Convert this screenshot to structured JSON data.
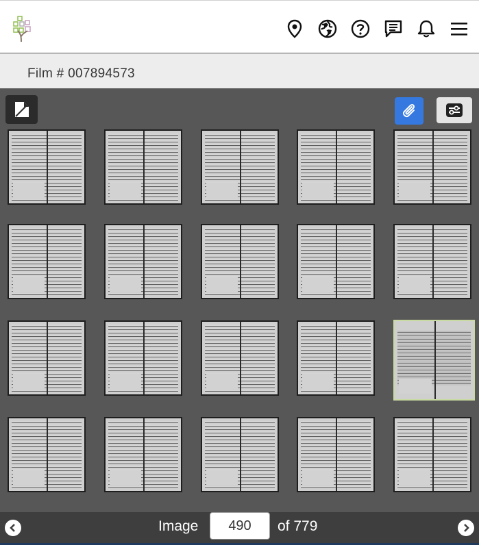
{
  "header": {
    "logo_icon": "familysearch-tree-logo",
    "nav_icons": [
      "map-pin-icon",
      "globe-icon",
      "help-icon",
      "chat-icon",
      "bell-icon",
      "menu-icon"
    ]
  },
  "film": {
    "label": "Film #",
    "number": "007894573"
  },
  "toolbar": {
    "doc_icon": "document-icon",
    "attach_icon": "paperclip-icon",
    "settings_icon": "sliders-icon",
    "attach_color": "#3579e0"
  },
  "thumbnails": {
    "rows": 4,
    "cols": 5,
    "selected_index": 14,
    "selected_border_color": "#c9dba3"
  },
  "pager": {
    "image_label": "Image",
    "current": "490",
    "of_label": "of 779"
  }
}
